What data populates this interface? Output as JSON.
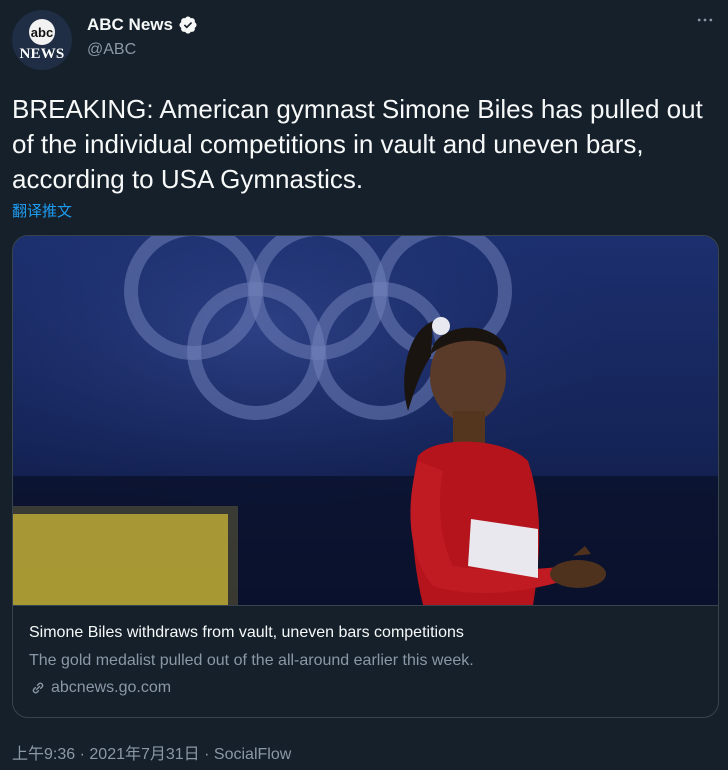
{
  "author": {
    "avatar_top": "abc",
    "avatar_bottom": "NEWS",
    "name": "ABC News",
    "handle": "@ABC",
    "verified_icon": "verified-badge-icon"
  },
  "more_icon": "more-options-icon",
  "tweet": {
    "text": "BREAKING: American gymnast Simone Biles has pulled out of the individual competitions in vault and uneven bars, according to USA Gymnastics.",
    "translate_label": "翻译推文"
  },
  "card": {
    "title": "Simone Biles withdraws from vault, uneven bars competitions",
    "description": "The gold medalist pulled out of the all-around earlier this week.",
    "domain": "abcnews.go.com",
    "link_icon": "link-icon"
  },
  "meta": {
    "time": "上午9:36",
    "separator": "·",
    "date": "2021年7月31日",
    "source": "SocialFlow"
  },
  "colors": {
    "background": "#15202b",
    "text": "#f7f9f9",
    "secondary": "#8b98a5",
    "accent": "#1d9bf0",
    "border": "#38444d"
  }
}
